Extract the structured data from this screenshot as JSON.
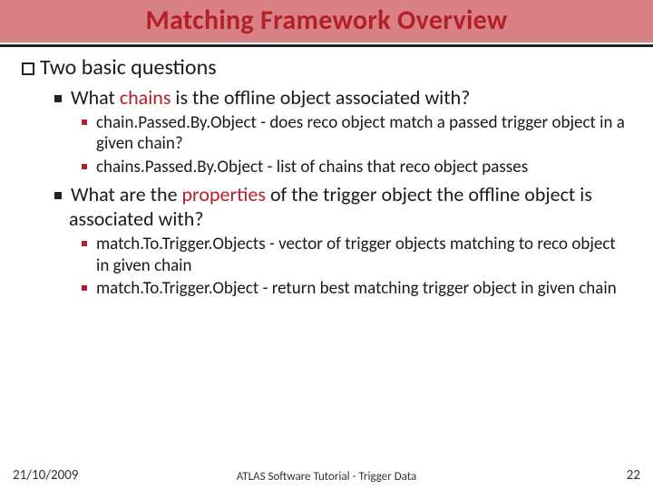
{
  "title": "Matching Framework Overview",
  "lvl1": "Two basic questions",
  "q1": {
    "pre": "What ",
    "hl": "chains",
    "post": " is the offline object associated with?",
    "items": [
      {
        "name": "chain.Passed.By.Object",
        "desc": " - does reco object match a passed trigger object in a given chain?"
      },
      {
        "name": "chains.Passed.By.Object",
        "desc": " - list of chains that reco object passes"
      }
    ]
  },
  "q2": {
    "pre": "What are the ",
    "hl": "properties",
    "post": " of the trigger object the offline object is associated with?",
    "items": [
      {
        "name": "match.To.Trigger.Objects",
        "desc": " - vector of trigger objects matching to reco object in given chain"
      },
      {
        "name": "match.To.Trigger.Object",
        "desc": " - return best matching trigger object in given chain"
      }
    ]
  },
  "footer": {
    "date": "21/10/2009",
    "center": "ATLAS Software Tutorial - Trigger Data",
    "num": "22"
  }
}
